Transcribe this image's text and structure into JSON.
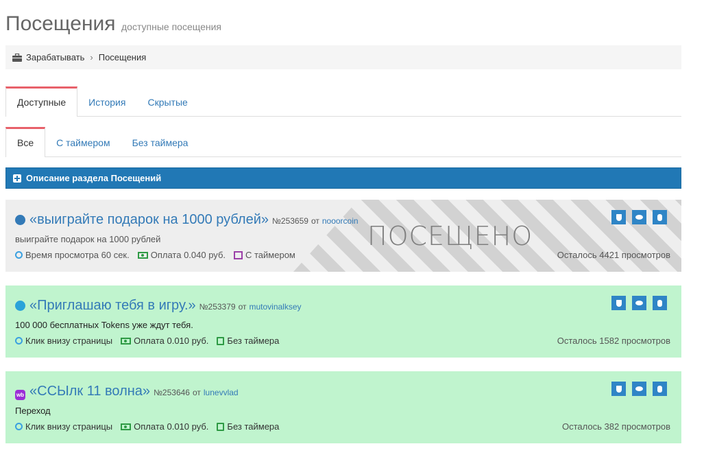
{
  "header": {
    "title": "Посещения",
    "subtitle": "доступные посещения"
  },
  "breadcrumb": {
    "icon": "briefcase-icon",
    "items": [
      "Зарабатывать",
      "Посещения"
    ]
  },
  "main_tabs": [
    {
      "label": "Доступные",
      "active": true
    },
    {
      "label": "История",
      "active": false
    },
    {
      "label": "Скрытые",
      "active": false
    }
  ],
  "sub_tabs": [
    {
      "label": "Все",
      "active": true
    },
    {
      "label": "С таймером",
      "active": false
    },
    {
      "label": "Без таймера",
      "active": false
    }
  ],
  "description_bar": {
    "label": "Описание раздела Посещений",
    "color": "#2178b5"
  },
  "visits": [
    {
      "icon": "globe-icon",
      "title": "«выиграйте подарок на 1000 рублей»",
      "number": "№253659",
      "by": "от",
      "user": "nooorcoin",
      "description": "выиграйте подарок на 1000 рублей",
      "meta": {
        "type": "Время просмотра 60 сек.",
        "pay": "Оплата 0.040 руб.",
        "timer": "С таймером"
      },
      "remaining": "Осталось 4421 просмотров",
      "status": "ПОСЕЩЕНО",
      "background": "#eeeeee"
    },
    {
      "icon": "telegram-icon",
      "title": "«Приглашаю тебя в игру.»",
      "number": "№253379",
      "by": "от",
      "user": "mutovinalksey",
      "description": "100 000 бесплатных Tokens уже ждут тебя.",
      "meta": {
        "type": "Клик внизу страницы",
        "pay": "Оплата 0.010 руб.",
        "timer": "Без таймера"
      },
      "remaining": "Осталось 1582 просмотров",
      "background": "#c0f4ce"
    },
    {
      "icon": "wb-icon",
      "icon_text": "wb",
      "title": "«ССЫлк 11 волна»",
      "number": "№253646",
      "by": "от",
      "user": "lunevvlad",
      "description": "Переход",
      "meta": {
        "type": "Клик внизу страницы",
        "pay": "Оплата 0.010 руб.",
        "timer": "Без таймера"
      },
      "remaining": "Осталось 382 просмотров",
      "background": "#c0f4ce"
    }
  ],
  "actions": [
    "shield-icon",
    "hide-eye-icon",
    "bug-icon"
  ]
}
